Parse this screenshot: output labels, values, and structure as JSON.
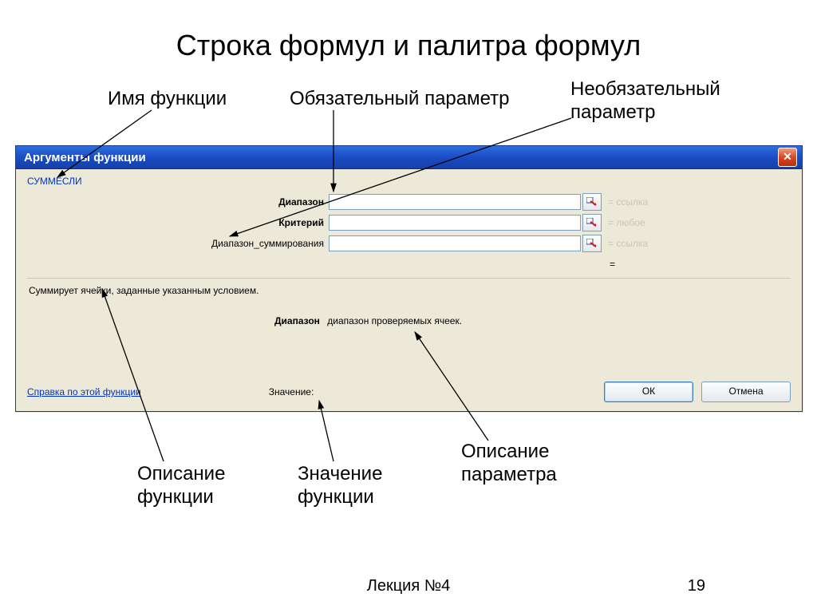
{
  "slide": {
    "title": "Строка формул и палитра формул",
    "footer_left": "Лекция №4",
    "footer_right": "19"
  },
  "annotations": {
    "func_name": "Имя функции",
    "required_param": "Обязательный параметр",
    "optional_param": "Необязательный\nпараметр",
    "func_desc": "Описание\nфункции",
    "func_value": "Значение\nфункции",
    "param_desc": "Описание\nпараметра"
  },
  "dialog": {
    "title": "Аргументы функции",
    "function_name": "СУММЕСЛИ",
    "params": [
      {
        "label": "Диапазон",
        "bold": true,
        "value": "",
        "result_prefix": "=",
        "result": "ссылка"
      },
      {
        "label": "Критерий",
        "bold": true,
        "value": "",
        "result_prefix": "=",
        "result": "любое"
      },
      {
        "label": "Диапазон_суммирования",
        "bold": false,
        "value": "",
        "result_prefix": "=",
        "result": "ссылка"
      }
    ],
    "eq_sign": "=",
    "description": "Суммирует ячейки, заданные указанным условием.",
    "param_help_name": "Диапазон",
    "param_help_text": "диапазон проверяемых ячеек.",
    "help_link": "Справка по этой функции",
    "value_label": "Значение:",
    "ok": "ОК",
    "cancel": "Отмена"
  }
}
